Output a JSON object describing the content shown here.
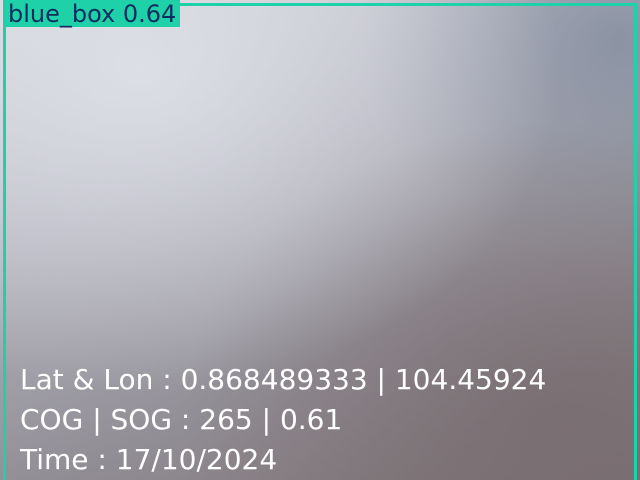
{
  "detection": {
    "label": "blue_box 0.64",
    "box_color": "#1fd1a8",
    "label_text_color": "#0e2d5e"
  },
  "telemetry": {
    "lat_lon": "Lat & Lon : 0.868489333 | 104.45924",
    "cog_sog": "COG | SOG : 265 | 0.61",
    "time": "Time : 17/10/2024",
    "text_color": "#ffffff"
  }
}
